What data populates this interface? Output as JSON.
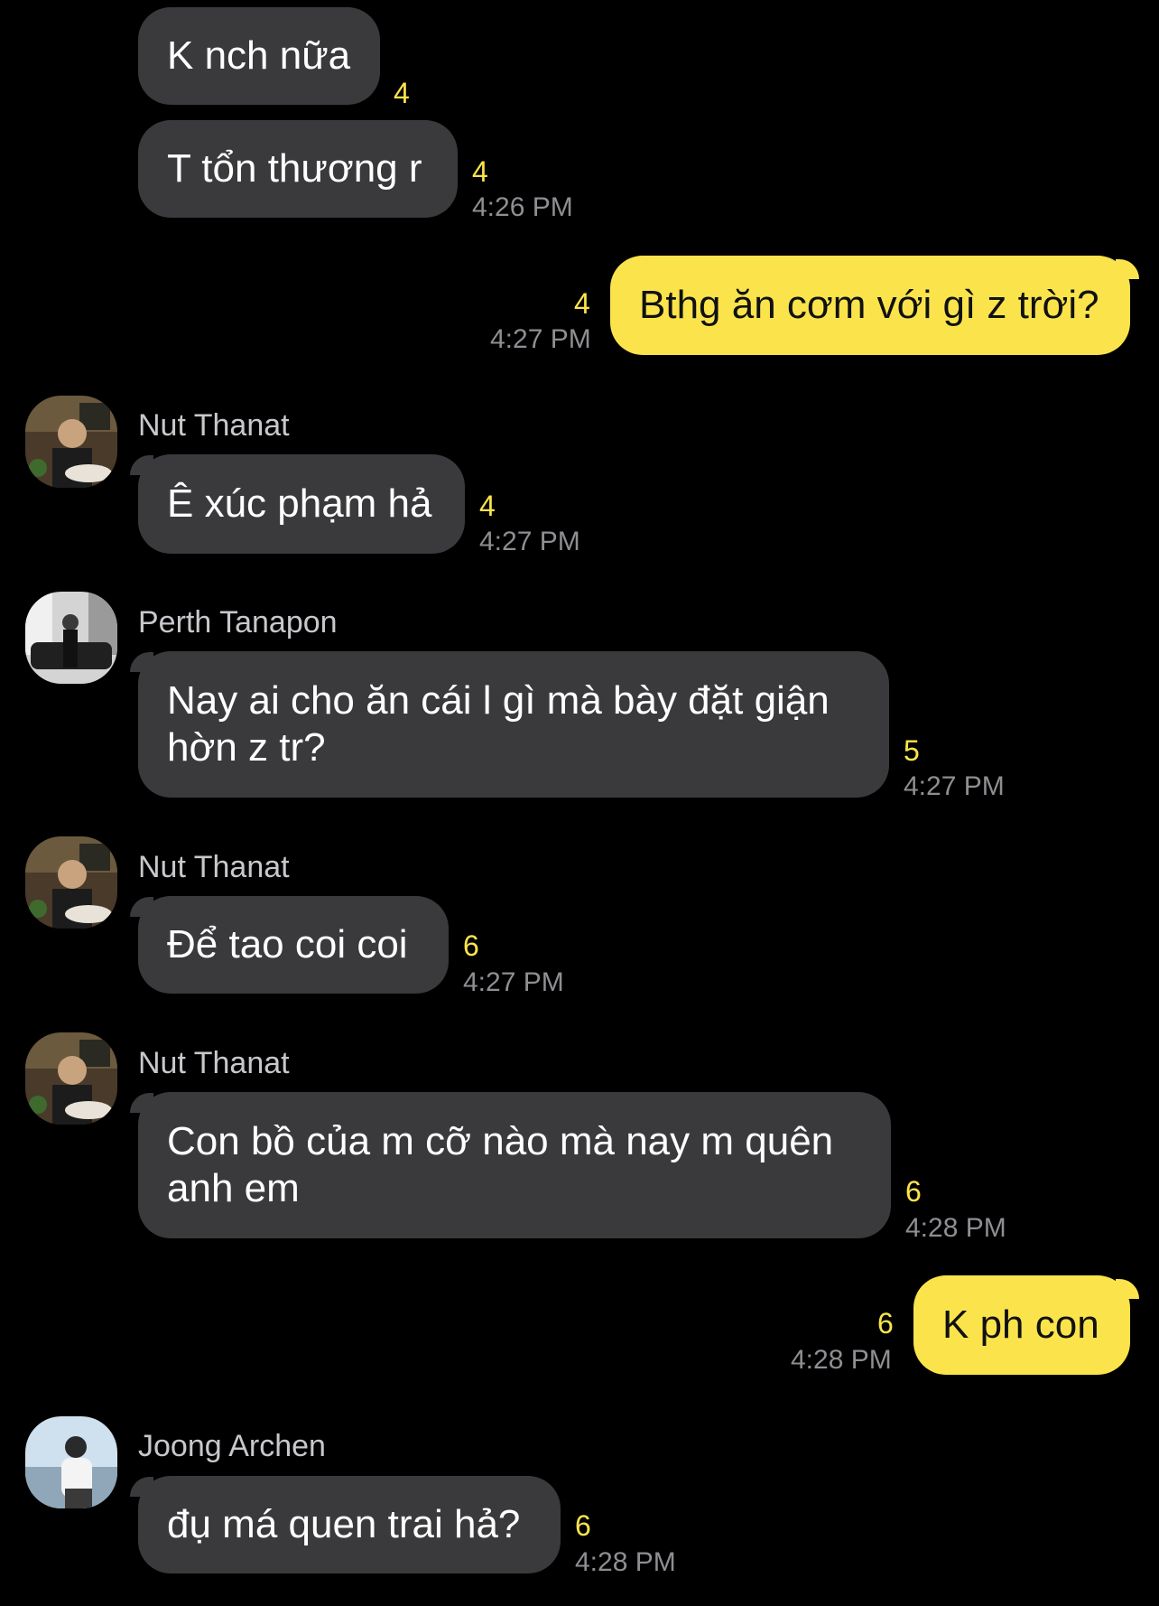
{
  "messages": [
    {
      "text": "K nch nữa",
      "count": "4"
    },
    {
      "text": "T tổn thương r",
      "count": "4",
      "time": "4:26 PM"
    },
    {
      "text": "Bthg ăn cơm với gì z trời?",
      "count": "4",
      "time": "4:27 PM"
    },
    {
      "sender": "Nut Thanat",
      "text": "Ê xúc phạm hả",
      "count": "4",
      "time": "4:27 PM"
    },
    {
      "sender": "Perth Tanapon",
      "text": "Nay ai cho ăn cái l gì mà bày đặt giận hờn z tr?",
      "count": "5",
      "time": "4:27 PM"
    },
    {
      "sender": "Nut Thanat",
      "text": "Để tao coi coi",
      "count": "6",
      "time": "4:27 PM"
    },
    {
      "sender": "Nut Thanat",
      "text": "Con bồ của m cỡ nào mà nay m quên anh em",
      "count": "6",
      "time": "4:28 PM"
    },
    {
      "text": "K ph con",
      "count": "6",
      "time": "4:28 PM"
    },
    {
      "sender": "Joong Archen",
      "text": "đụ má quen trai hả?",
      "count": "6",
      "time": "4:28 PM"
    }
  ],
  "colors": {
    "background": "#000000",
    "incoming_bubble": "#3a3a3c",
    "outgoing_bubble": "#fbe44b",
    "unread_count": "#fbe44b",
    "timestamp": "#8e8e93"
  }
}
